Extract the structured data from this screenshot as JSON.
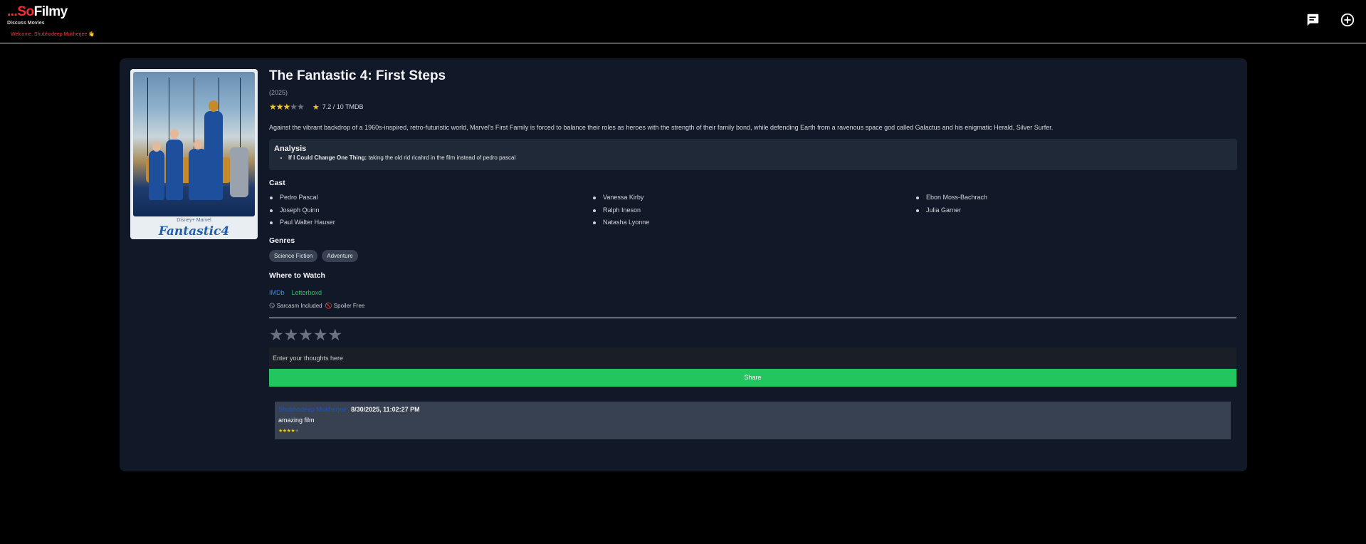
{
  "header": {
    "logo_part1": "...So",
    "logo_part2": "Filmy",
    "tagline": "Discuss Movies",
    "welcome": "Welcome, Shubhodeep Mukherjee 👋",
    "icons": [
      "message-icon",
      "add-circle-icon"
    ]
  },
  "movie": {
    "title": "The Fantastic 4: First Steps",
    "year": "(2025)",
    "star_rating": 3,
    "star_max": 5,
    "tmdb_score": "7.2 / 10 TMDB",
    "overview": "Against the vibrant backdrop of a 1960s-inspired, retro-futuristic world, Marvel's First Family is forced to balance their roles as heroes with the strength of their family bond, while defending Earth from a ravenous space god called Galactus and his enigmatic Herald, Silver Surfer.",
    "poster": {
      "brand": "Disney+ Marvel",
      "title_text": "Fantastic4"
    }
  },
  "analysis": {
    "heading": "Analysis",
    "item_title": "If I Could Change One Thing:",
    "item_text": " taking the old rid ricahrd in the film instead of pedro pascal"
  },
  "cast": {
    "heading": "Cast",
    "members": [
      "Pedro Pascal",
      "Vanessa Kirby",
      "Ebon Moss-Bachrach",
      "Joseph Quinn",
      "Ralph Ineson",
      "Julia Garner",
      "Paul Walter Hauser",
      "Natasha Lyonne"
    ]
  },
  "genres": {
    "heading": "Genres",
    "items": [
      "Science Fiction",
      "Adventure"
    ]
  },
  "watch": {
    "heading": "Where to Watch",
    "imdb": "IMDb",
    "letterboxd": "Letterboxd",
    "link_colors": {
      "imdb": "#3b82f6",
      "letterboxd": "#22c55e"
    }
  },
  "badges": {
    "sarcasm": "😏 Sarcasm Included",
    "spoiler": "🚫 Spoiler Free"
  },
  "review_form": {
    "placeholder": "Enter your thoughts here",
    "share_label": "Share",
    "selected_stars": 0
  },
  "comments": [
    {
      "user": "Shubhodeep Mukherjee",
      "date": "8/30/2025, 11:02:27 PM",
      "text": "amazing film",
      "rating": 3.5
    }
  ],
  "colors": {
    "accent_red": "#ff2d2d",
    "share_green": "#22c55e",
    "star_gold": "#f5c518",
    "card_bg": "#111827"
  }
}
